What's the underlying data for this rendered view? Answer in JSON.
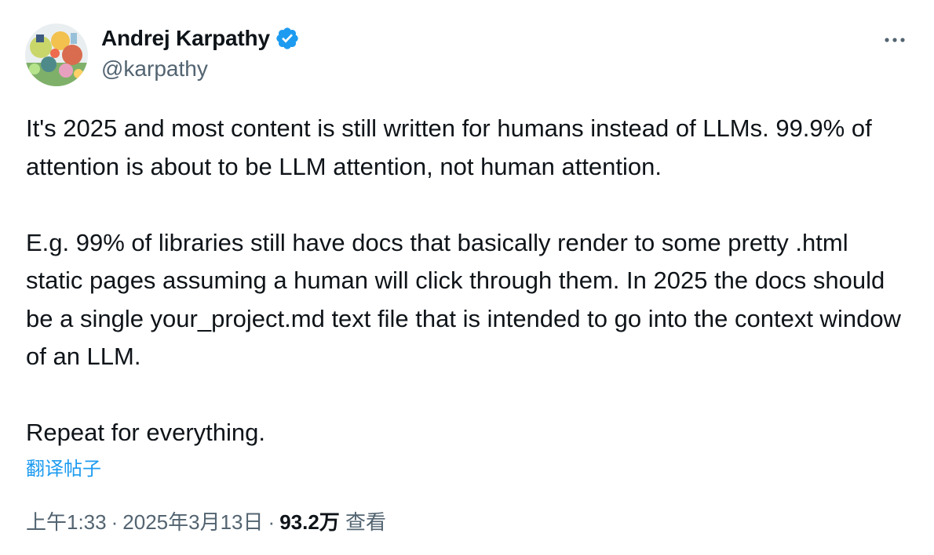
{
  "author": {
    "display_name": "Andrej Karpathy",
    "handle": "@karpathy",
    "verified": true
  },
  "menu": {
    "more_icon": "more-horizontal-icon"
  },
  "tweet": {
    "paragraphs": [
      "It's 2025 and most content is still written for humans instead of LLMs. 99.9% of attention is about to be LLM attention, not human attention.",
      "E.g. 99% of libraries still have docs that basically render to some pretty .html static pages assuming a human will click through them. In 2025 the docs should be a single your_project.md text file that is intended to go into the context window of an LLM.",
      "Repeat for everything."
    ],
    "translate_label": "翻译帖子"
  },
  "meta": {
    "time": "上午1:33",
    "separator": "·",
    "date": "2025年3月13日",
    "views_count": "93.2万",
    "views_label": "查看"
  },
  "colors": {
    "text": "#0f1419",
    "secondary": "#536471",
    "accent": "#1d9bf0"
  }
}
